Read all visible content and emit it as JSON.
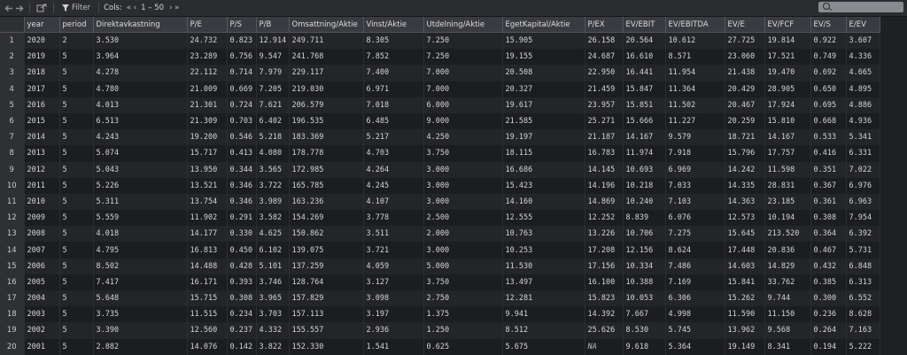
{
  "toolbar": {
    "filter_label": "Filter",
    "cols_label": "Cols:",
    "cols_prev": "« ‹",
    "cols_range": "1 – 50",
    "cols_next": "› »",
    "search_placeholder": ""
  },
  "columns": [
    "year",
    "period",
    "Direktavkastning",
    "P/E",
    "P/S",
    "P/B",
    "Omsattning/Aktie",
    "Vinst/Aktie",
    "Utdelning/Aktie",
    "EgetKapital/Aktie",
    "P/EX",
    "EV/EBIT",
    "EV/EBITDA",
    "EV/E",
    "EV/FCF",
    "EV/S",
    "E/EV"
  ],
  "rows": [
    [
      "1",
      "2020",
      "2",
      "3.530",
      "24.732",
      "0.823",
      "12.914",
      "249.711",
      "8.305",
      "7.250",
      "15.905",
      "26.158",
      "20.564",
      "10.612",
      "27.725",
      "19.814",
      "0.922",
      "3.607"
    ],
    [
      "2",
      "2019",
      "5",
      "3.964",
      "23.289",
      "0.756",
      "9.547",
      "241.768",
      "7.852",
      "7.250",
      "19.155",
      "24.687",
      "16.610",
      "8.571",
      "23.060",
      "17.521",
      "0.749",
      "4.336"
    ],
    [
      "3",
      "2018",
      "5",
      "4.278",
      "22.112",
      "0.714",
      "7.979",
      "229.117",
      "7.400",
      "7.000",
      "20.508",
      "22.950",
      "16.441",
      "11.954",
      "21.438",
      "19.470",
      "0.692",
      "4.665"
    ],
    [
      "4",
      "2017",
      "5",
      "4.780",
      "21.009",
      "0.669",
      "7.205",
      "219.030",
      "6.971",
      "7.000",
      "20.327",
      "21.459",
      "15.847",
      "11.364",
      "20.429",
      "28.905",
      "0.650",
      "4.895"
    ],
    [
      "5",
      "2016",
      "5",
      "4.013",
      "21.301",
      "0.724",
      "7.621",
      "206.579",
      "7.018",
      "6.000",
      "19.617",
      "23.957",
      "15.851",
      "11.502",
      "20.467",
      "17.924",
      "0.695",
      "4.886"
    ],
    [
      "6",
      "2015",
      "5",
      "6.513",
      "21.309",
      "0.703",
      "6.402",
      "196.535",
      "6.485",
      "9.000",
      "21.585",
      "25.271",
      "15.666",
      "11.227",
      "20.259",
      "15.810",
      "0.668",
      "4.936"
    ],
    [
      "7",
      "2014",
      "5",
      "4.243",
      "19.200",
      "0.546",
      "5.218",
      "183.369",
      "5.217",
      "4.250",
      "19.197",
      "21.187",
      "14.167",
      "9.579",
      "18.721",
      "14.167",
      "0.533",
      "5.341"
    ],
    [
      "8",
      "2013",
      "5",
      "5.074",
      "15.717",
      "0.413",
      "4.080",
      "178.778",
      "4.703",
      "3.750",
      "18.115",
      "16.783",
      "11.974",
      "7.918",
      "15.796",
      "17.757",
      "0.416",
      "6.331"
    ],
    [
      "9",
      "2012",
      "5",
      "5.043",
      "13.950",
      "0.344",
      "3.565",
      "172.985",
      "4.264",
      "3.000",
      "16.686",
      "14.145",
      "10.693",
      "6.969",
      "14.242",
      "11.598",
      "0.351",
      "7.022"
    ],
    [
      "10",
      "2011",
      "5",
      "5.226",
      "13.521",
      "0.346",
      "3.722",
      "165.785",
      "4.245",
      "3.000",
      "15.423",
      "14.196",
      "10.218",
      "7.033",
      "14.335",
      "28.831",
      "0.367",
      "6.976"
    ],
    [
      "11",
      "2010",
      "5",
      "5.311",
      "13.754",
      "0.346",
      "3.989",
      "163.236",
      "4.107",
      "3.000",
      "14.160",
      "14.869",
      "10.240",
      "7.103",
      "14.363",
      "23.185",
      "0.361",
      "6.963"
    ],
    [
      "12",
      "2009",
      "5",
      "5.559",
      "11.902",
      "0.291",
      "3.582",
      "154.269",
      "3.778",
      "2.500",
      "12.555",
      "12.252",
      "8.839",
      "6.076",
      "12.573",
      "10.194",
      "0.308",
      "7.954"
    ],
    [
      "13",
      "2008",
      "5",
      "4.018",
      "14.177",
      "0.330",
      "4.625",
      "150.862",
      "3.511",
      "2.000",
      "10.763",
      "13.226",
      "10.706",
      "7.275",
      "15.645",
      "213.520",
      "0.364",
      "6.392"
    ],
    [
      "14",
      "2007",
      "5",
      "4.795",
      "16.813",
      "0.450",
      "6.102",
      "139.075",
      "3.721",
      "3.000",
      "10.253",
      "17.208",
      "12.156",
      "8.624",
      "17.448",
      "20.836",
      "0.467",
      "5.731"
    ],
    [
      "15",
      "2006",
      "5",
      "8.502",
      "14.488",
      "0.428",
      "5.101",
      "137.259",
      "4.059",
      "5.000",
      "11.530",
      "17.156",
      "10.334",
      "7.486",
      "14.603",
      "14.829",
      "0.432",
      "6.848"
    ],
    [
      "16",
      "2005",
      "5",
      "7.417",
      "16.171",
      "0.393",
      "3.746",
      "128.764",
      "3.127",
      "3.750",
      "13.497",
      "16.100",
      "10.388",
      "7.169",
      "15.841",
      "33.762",
      "0.385",
      "6.313"
    ],
    [
      "17",
      "2004",
      "5",
      "5.648",
      "15.715",
      "0.308",
      "3.965",
      "157.829",
      "3.098",
      "2.750",
      "12.281",
      "15.823",
      "10.053",
      "6.306",
      "15.262",
      "9.744",
      "0.300",
      "6.552"
    ],
    [
      "18",
      "2003",
      "5",
      "3.735",
      "11.515",
      "0.234",
      "3.703",
      "157.113",
      "3.197",
      "1.375",
      "9.941",
      "14.392",
      "7.667",
      "4.998",
      "11.590",
      "11.150",
      "0.236",
      "8.628"
    ],
    [
      "19",
      "2002",
      "5",
      "3.390",
      "12.560",
      "0.237",
      "4.332",
      "155.557",
      "2.936",
      "1.250",
      "8.512",
      "25.626",
      "8.530",
      "5.745",
      "13.962",
      "9.568",
      "0.264",
      "7.163"
    ],
    [
      "20",
      "2001",
      "5",
      "2.882",
      "14.076",
      "0.142",
      "3.822",
      "152.330",
      "1.541",
      "0.625",
      "5.675",
      "NA",
      "9.618",
      "5.364",
      "19.149",
      "8.341",
      "0.194",
      "5.222"
    ]
  ]
}
